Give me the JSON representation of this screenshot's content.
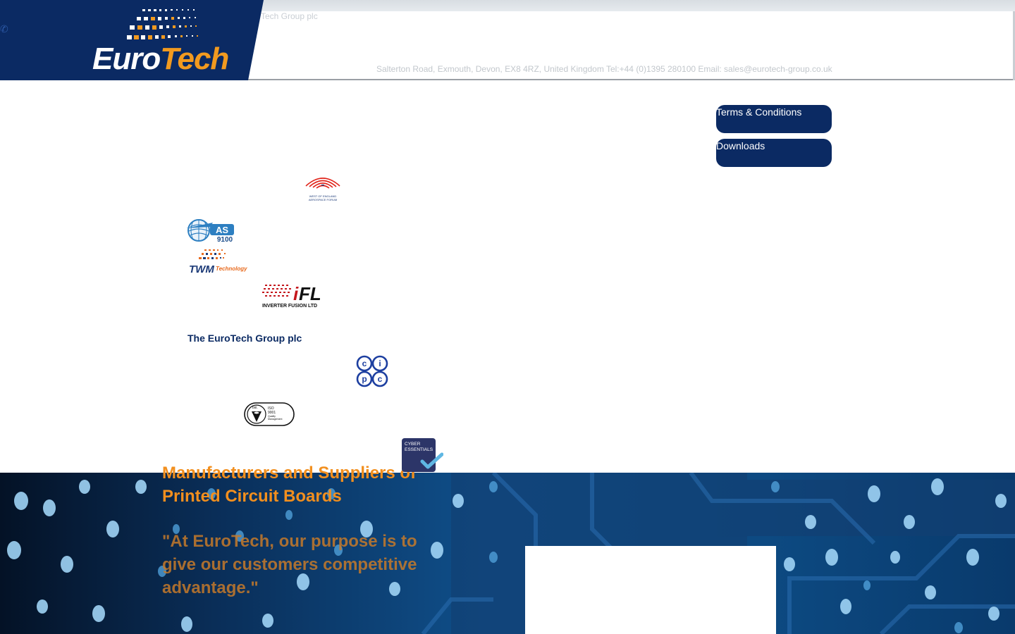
{
  "header": {
    "brand_partial": "Tech Group plc",
    "contact": "Salterton Road, Exmouth, Devon, EX8 4RZ, United Kingdom  Tel:+44 (0)1395 280100 Email: sales@eurotech-group.co.uk",
    "logo": {
      "euro": "Euro",
      "tech": "Tech"
    },
    "phone_icon": "phone-icon"
  },
  "nav": {
    "terms_label": "Terms & Conditions",
    "downloads_label": "Downloads"
  },
  "badges": {
    "weaf": "WEST OF ENGLAND AEROSPACE FORUM",
    "as9100": "AS 9100",
    "twm": {
      "main": "TWM",
      "sub": "Technology"
    },
    "ifl": {
      "mark": "iFL",
      "sub": "INVERTER FUSION LTD"
    },
    "ipc": [
      "c",
      "i",
      "p",
      "c"
    ],
    "bsi": {
      "brand": "bsi.",
      "std": "ISO",
      "num": "9001",
      "l1": "Quality",
      "l2": "Management"
    },
    "cyber": {
      "l1": "CYBER",
      "l2": "ESSENTIALS"
    }
  },
  "group_title": "The EuroTech Group plc",
  "hero": {
    "title": "Manufacturers and Suppliers of Printed Circuit Boards",
    "quote": "\"At EuroTech, our purpose is to give our customers competitive advantage.\""
  },
  "colors": {
    "brand_navy": "#0b2a63",
    "brand_orange": "#f29a1f"
  }
}
